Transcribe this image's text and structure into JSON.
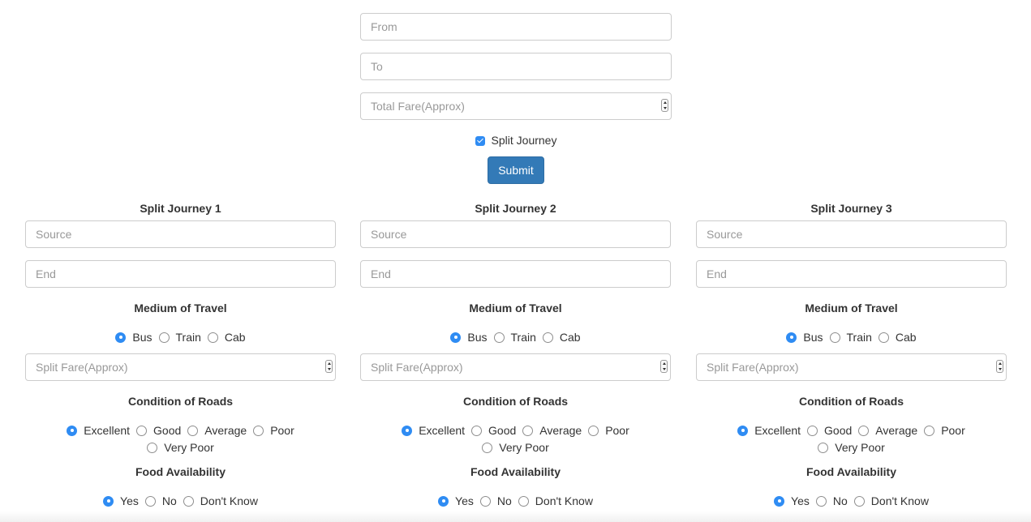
{
  "main_form": {
    "from_placeholder": "From",
    "to_placeholder": "To",
    "fare_placeholder": "Total Fare(Approx)",
    "split_checkbox_label": "Split Journey",
    "split_checked": true,
    "submit_label": "Submit"
  },
  "journeys": [
    {
      "title": "Split Journey 1",
      "source_placeholder": "Source",
      "end_placeholder": "End",
      "medium_title": "Medium of Travel",
      "medium_options": [
        "Bus",
        "Train",
        "Cab"
      ],
      "fare_placeholder": "Split Fare(Approx)",
      "roads_title": "Condition of Roads",
      "road_options": [
        "Excellent",
        "Good",
        "Average",
        "Poor"
      ],
      "road_option_extra": "Very Poor",
      "food_title": "Food Availability",
      "food_options": [
        "Yes",
        "No",
        "Don't Know"
      ]
    },
    {
      "title": "Split Journey 2",
      "source_placeholder": "Source",
      "end_placeholder": "End",
      "medium_title": "Medium of Travel",
      "medium_options": [
        "Bus",
        "Train",
        "Cab"
      ],
      "fare_placeholder": "Split Fare(Approx)",
      "roads_title": "Condition of Roads",
      "road_options": [
        "Excellent",
        "Good",
        "Average",
        "Poor"
      ],
      "road_option_extra": "Very Poor",
      "food_title": "Food Availability",
      "food_options": [
        "Yes",
        "No",
        "Don't Know"
      ]
    },
    {
      "title": "Split Journey 3",
      "source_placeholder": "Source",
      "end_placeholder": "End",
      "medium_title": "Medium of Travel",
      "medium_options": [
        "Bus",
        "Train",
        "Cab"
      ],
      "fare_placeholder": "Split Fare(Approx)",
      "roads_title": "Condition of Roads",
      "road_options": [
        "Excellent",
        "Good",
        "Average",
        "Poor"
      ],
      "road_option_extra": "Very Poor",
      "food_title": "Food Availability",
      "food_options": [
        "Yes",
        "No",
        "Don't Know"
      ]
    }
  ],
  "colors": {
    "accent": "#2f8cf3",
    "button": "#337ab7",
    "border": "#cccccc",
    "text": "#333333",
    "placeholder": "#999999"
  }
}
